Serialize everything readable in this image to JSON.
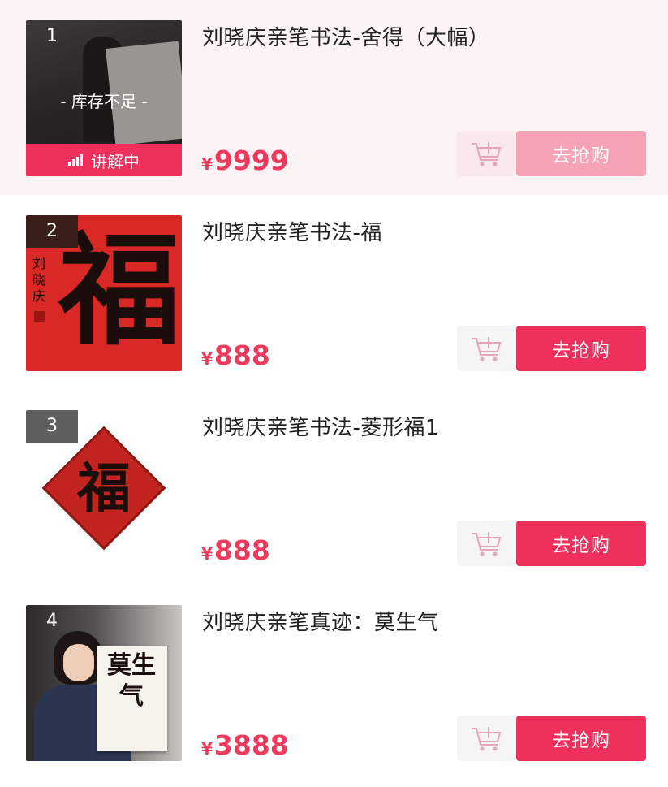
{
  "colors": {
    "accent": "#f0305c",
    "accent_disabled": "#f7a3b6",
    "price": "#ee3a5d",
    "active_row_bg": "#fdf2f4"
  },
  "currency_symbol": "¥",
  "items": [
    {
      "rank": "1",
      "title": "刘晓庆亲笔书法-舍得（大幅）",
      "price": "9999",
      "stock_status": "- 库存不足 -",
      "live_badge": "讲解中",
      "buy_label": "去抢购",
      "cart_icon": "cart-add-icon",
      "rank_bg": "transparent",
      "state": "low-stock"
    },
    {
      "rank": "2",
      "title": "刘晓庆亲笔书法-福",
      "price": "888",
      "buy_label": "去抢购",
      "cart_icon": "cart-add-icon",
      "rank_bg": "#3a1f1c",
      "thumb_char": "福",
      "thumb_signature": "刘晓庆"
    },
    {
      "rank": "3",
      "title": "刘晓庆亲笔书法-菱形福1",
      "price": "888",
      "buy_label": "去抢购",
      "cart_icon": "cart-add-icon",
      "rank_bg": "#5f5f5f",
      "thumb_char": "福"
    },
    {
      "rank": "4",
      "title": "刘晓庆亲笔真迹：莫生气",
      "price": "3888",
      "buy_label": "去抢购",
      "cart_icon": "cart-add-icon",
      "rank_bg": "transparent",
      "thumb_chars": "莫生气"
    }
  ]
}
